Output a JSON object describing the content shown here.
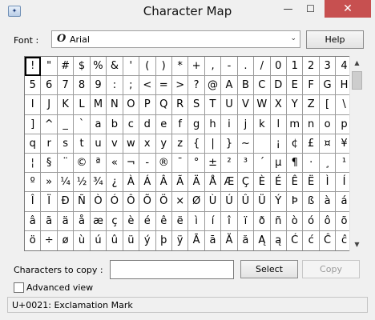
{
  "window": {
    "title": "Character Map",
    "minimize_glyph": "—",
    "maximize_glyph": "☐",
    "close_glyph": "✕"
  },
  "font": {
    "label": "Font :",
    "selected": "Arial",
    "icon": "opentype-font-icon",
    "help_label": "Help"
  },
  "grid": {
    "selected_index": 0,
    "rows": [
      [
        "!",
        "\"",
        "#",
        "$",
        "%",
        "&",
        "'",
        "(",
        ")",
        "*",
        "+",
        ",",
        "-",
        ".",
        "/",
        "0",
        "1",
        "2",
        "3",
        "4"
      ],
      [
        "5",
        "6",
        "7",
        "8",
        "9",
        ":",
        ";",
        "<",
        "=",
        ">",
        "?",
        "@",
        "A",
        "B",
        "C",
        "D",
        "E",
        "F",
        "G",
        "H"
      ],
      [
        "I",
        "J",
        "K",
        "L",
        "M",
        "N",
        "O",
        "P",
        "Q",
        "R",
        "S",
        "T",
        "U",
        "V",
        "W",
        "X",
        "Y",
        "Z",
        "[",
        "\\"
      ],
      [
        "]",
        "^",
        "_",
        "`",
        "a",
        "b",
        "c",
        "d",
        "e",
        "f",
        "g",
        "h",
        "i",
        "j",
        "k",
        "l",
        "m",
        "n",
        "o",
        "p"
      ],
      [
        "q",
        "r",
        "s",
        "t",
        "u",
        "v",
        "w",
        "x",
        "y",
        "z",
        "{",
        "|",
        "}",
        "~",
        " ",
        "¡",
        "¢",
        "£",
        "¤",
        "¥"
      ],
      [
        "¦",
        "§",
        "¨",
        "©",
        "ª",
        "«",
        "¬",
        "-",
        "®",
        "¯",
        "°",
        "±",
        "²",
        "³",
        "´",
        "µ",
        "¶",
        "·",
        "¸",
        "¹"
      ],
      [
        "º",
        "»",
        "¼",
        "½",
        "¾",
        "¿",
        "À",
        "Á",
        "Â",
        "Ã",
        "Ä",
        "Å",
        "Æ",
        "Ç",
        "È",
        "É",
        "Ê",
        "Ë",
        "Ì",
        "Í"
      ],
      [
        "Î",
        "Ï",
        "Ð",
        "Ñ",
        "Ò",
        "Ó",
        "Ô",
        "Õ",
        "Ö",
        "×",
        "Ø",
        "Ù",
        "Ú",
        "Û",
        "Ü",
        "Ý",
        "Þ",
        "ß",
        "à",
        "á"
      ],
      [
        "â",
        "ã",
        "ä",
        "å",
        "æ",
        "ç",
        "è",
        "é",
        "ê",
        "ë",
        "ì",
        "í",
        "î",
        "ï",
        "ð",
        "ñ",
        "ò",
        "ó",
        "ô",
        "õ"
      ],
      [
        "ö",
        "÷",
        "ø",
        "ù",
        "ú",
        "û",
        "ü",
        "ý",
        "þ",
        "ÿ",
        "Ā",
        "ā",
        "Ă",
        "ă",
        "Ą",
        "ą",
        "Ć",
        "ć",
        "Ĉ",
        "ĉ"
      ]
    ]
  },
  "scrollbar": {
    "up_glyph": "▲",
    "down_glyph": "▼"
  },
  "copy": {
    "label": "Characters to copy :",
    "value": "",
    "select_label": "Select",
    "copy_label": "Copy"
  },
  "advanced": {
    "label": "Advanced view",
    "checked": false
  },
  "status": {
    "text": "U+0021: Exclamation Mark"
  }
}
